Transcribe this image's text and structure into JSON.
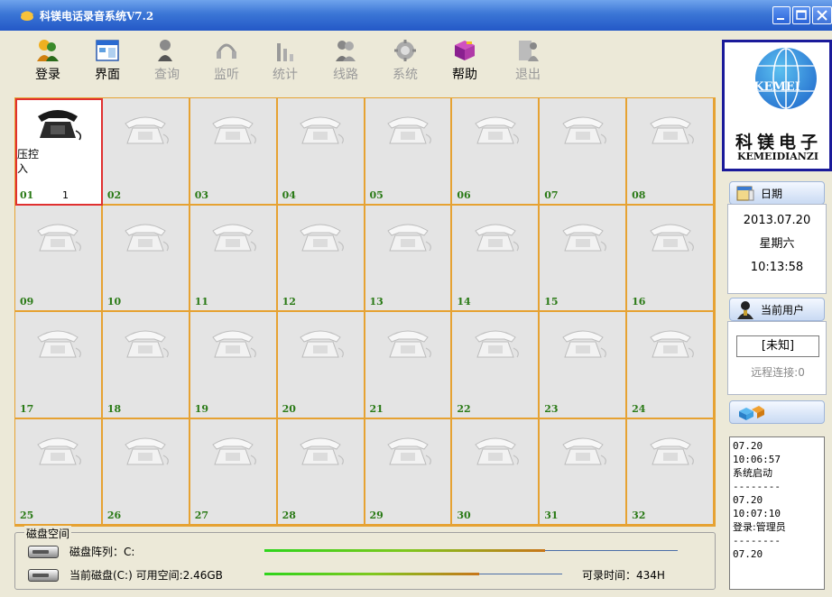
{
  "window": {
    "title": "科镁电话录音系统V7.2",
    "controls": [
      "minimize-icon",
      "maximize-icon",
      "close-icon"
    ]
  },
  "toolbar": {
    "items": [
      {
        "label": "登录",
        "icon": "login-users-icon",
        "enabled": true
      },
      {
        "label": "界面",
        "icon": "window-layout-icon",
        "enabled": true
      },
      {
        "label": "查询",
        "icon": "search-person-icon",
        "enabled": false
      },
      {
        "label": "监听",
        "icon": "headset-icon",
        "enabled": false
      },
      {
        "label": "统计",
        "icon": "bar-chart-icon",
        "enabled": false
      },
      {
        "label": "线路",
        "icon": "lines-icon",
        "enabled": false
      },
      {
        "label": "系统",
        "icon": "system-gear-icon",
        "enabled": false
      },
      {
        "label": "帮助",
        "icon": "help-book-icon",
        "enabled": true
      },
      {
        "label": "退出",
        "icon": "exit-icon",
        "enabled": false
      }
    ]
  },
  "channels": [
    {
      "num": "01",
      "count": "1",
      "status": "压控\n入",
      "active": true
    },
    {
      "num": "02"
    },
    {
      "num": "03"
    },
    {
      "num": "04"
    },
    {
      "num": "05"
    },
    {
      "num": "06"
    },
    {
      "num": "07"
    },
    {
      "num": "08"
    },
    {
      "num": "09"
    },
    {
      "num": "10"
    },
    {
      "num": "11"
    },
    {
      "num": "12"
    },
    {
      "num": "13"
    },
    {
      "num": "14"
    },
    {
      "num": "15"
    },
    {
      "num": "16"
    },
    {
      "num": "17"
    },
    {
      "num": "18"
    },
    {
      "num": "19"
    },
    {
      "num": "20"
    },
    {
      "num": "21"
    },
    {
      "num": "22"
    },
    {
      "num": "23"
    },
    {
      "num": "24"
    },
    {
      "num": "25"
    },
    {
      "num": "26"
    },
    {
      "num": "27"
    },
    {
      "num": "28"
    },
    {
      "num": "29"
    },
    {
      "num": "30"
    },
    {
      "num": "31"
    },
    {
      "num": "32"
    }
  ],
  "disk": {
    "legend": "磁盘空间",
    "array_label": "磁盘阵列：C:",
    "array_usage": 0.68,
    "current_label": "当前磁盘(C:) 可用空间:2.46GB",
    "current_usage": 0.72,
    "record_time": "可录时间：434H"
  },
  "logo": {
    "brand": "KEMEI",
    "cn": "科镁电子",
    "en": "KEMEIDIANZI"
  },
  "date_panel": {
    "title": "日期",
    "date": "2013.07.20",
    "weekday": "星期六",
    "time": "10:13:58"
  },
  "user_panel": {
    "title": "当前用户",
    "user": "[未知]",
    "remote": "远程连接:0"
  },
  "log": [
    "07.20",
    "10:06:57",
    "系统启动",
    "--------",
    "07.20",
    "10:07:10",
    "登录:管理员",
    "--------",
    "07.20"
  ],
  "colors": {
    "titlebar": "#2458c7",
    "grid_border": "#e6a232",
    "channel_number": "#2a7a16",
    "active_border": "#e03030",
    "logo_frame": "#1a1a9a"
  }
}
